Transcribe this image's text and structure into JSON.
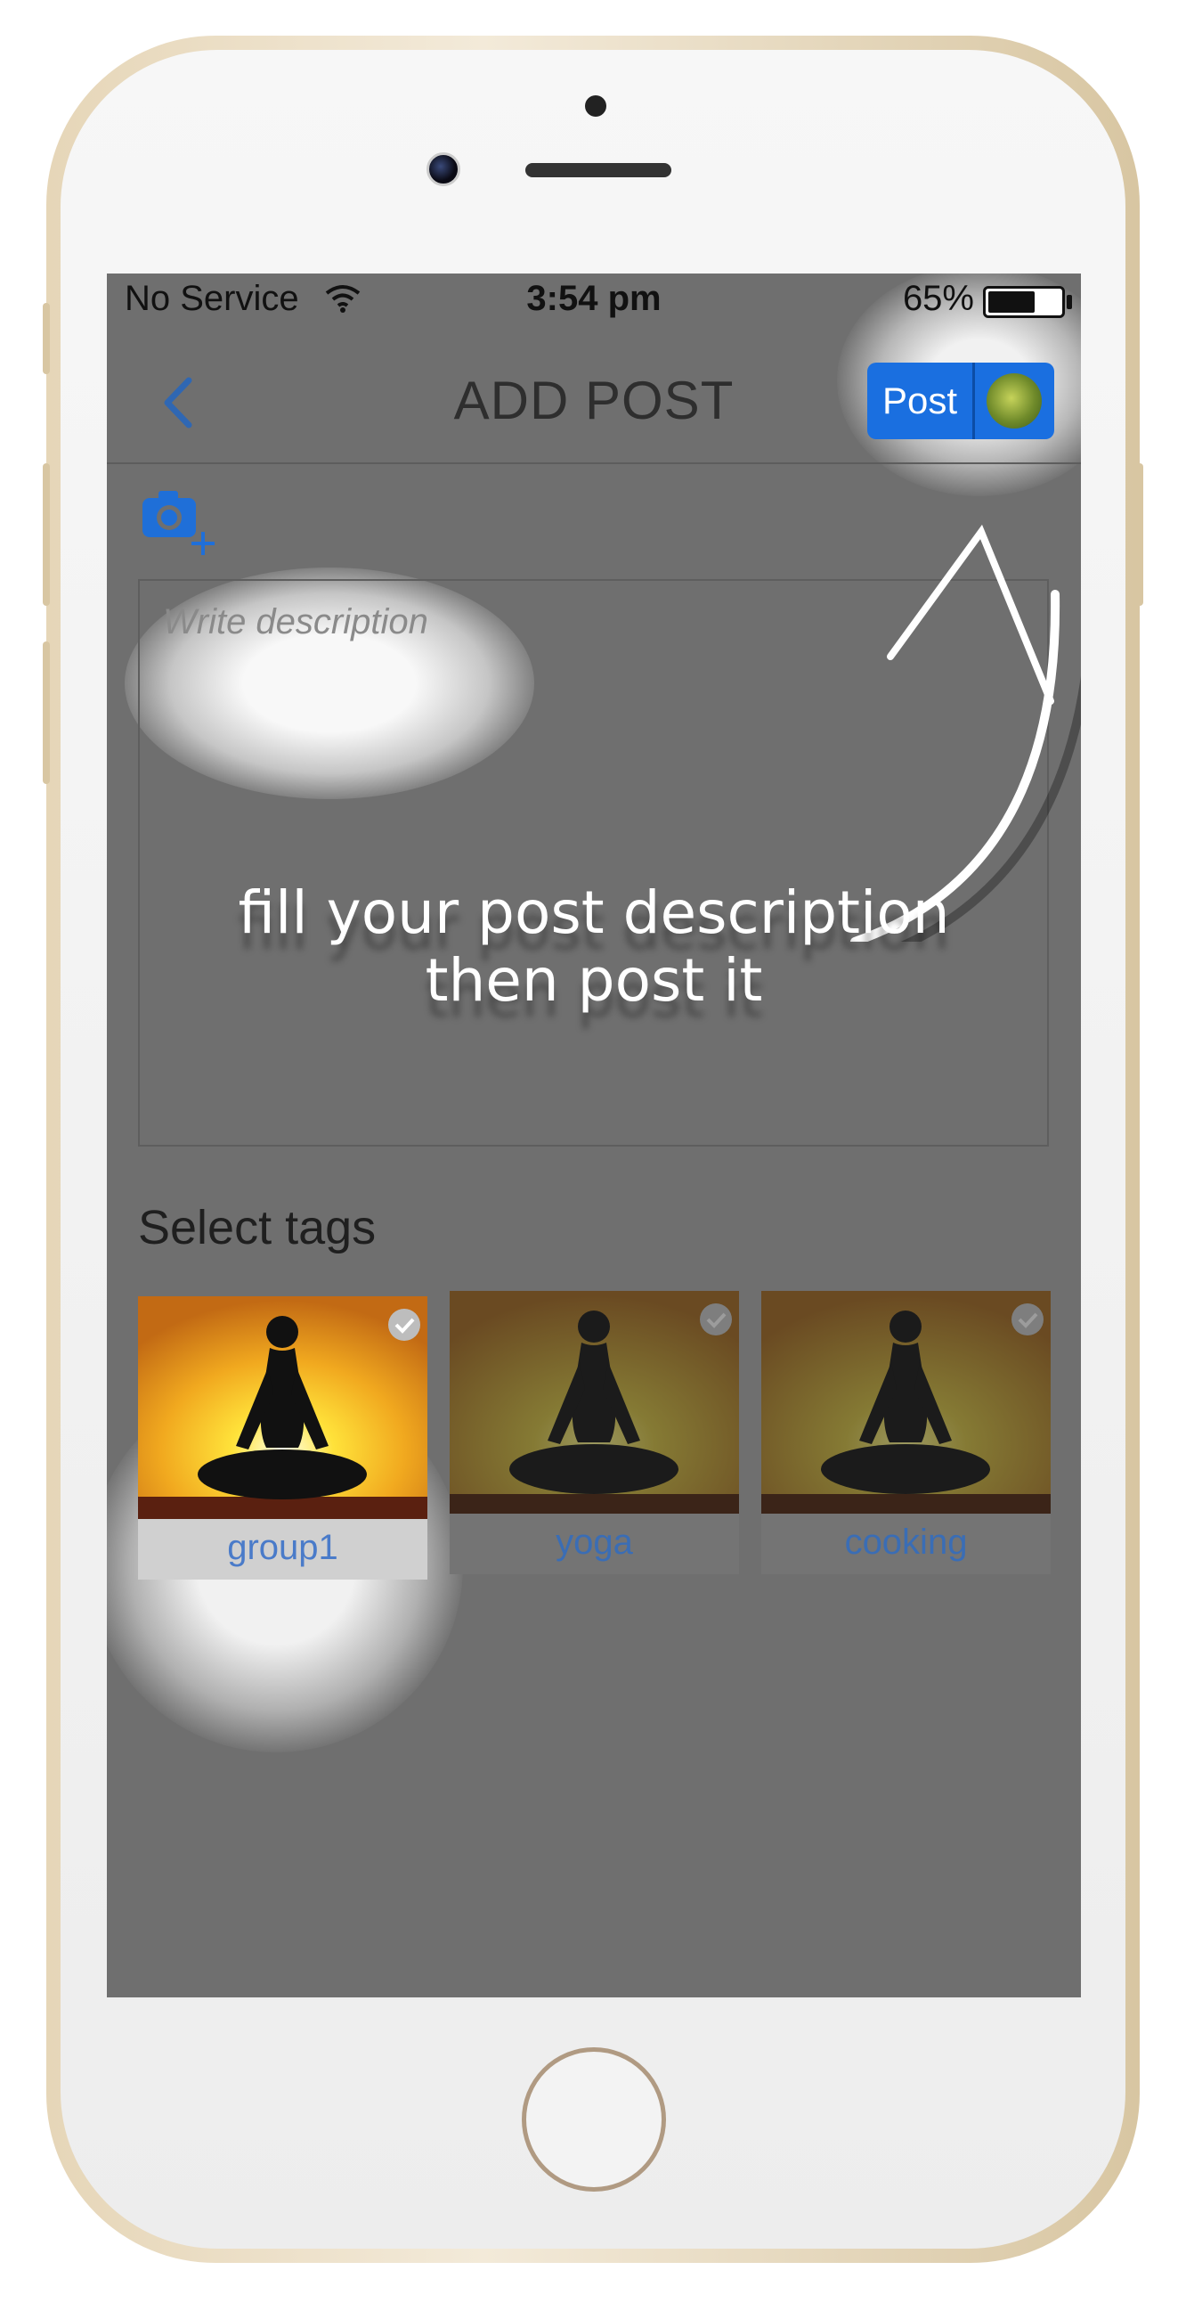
{
  "status_bar": {
    "carrier": "No Service",
    "time": "3:54 pm",
    "battery_percent": "65%",
    "battery_level": 0.65
  },
  "nav": {
    "title": "ADD POST",
    "post_label": "Post"
  },
  "description": {
    "placeholder": "Write description"
  },
  "hint": {
    "line1": "fill your post description",
    "line2": "then post it"
  },
  "tags": {
    "label": "Select tags",
    "items": [
      {
        "name": "group1",
        "selected": true
      },
      {
        "name": "yoga",
        "selected": false
      },
      {
        "name": "cooking",
        "selected": false
      }
    ]
  },
  "colors": {
    "accent": "#1a6fe0",
    "overlay": "#6f6f6f",
    "tag_text": "#3a6db5"
  },
  "icons": [
    "wifi-icon",
    "back-chevron-icon",
    "camera-add-icon",
    "check-icon",
    "arrow-annotation"
  ]
}
